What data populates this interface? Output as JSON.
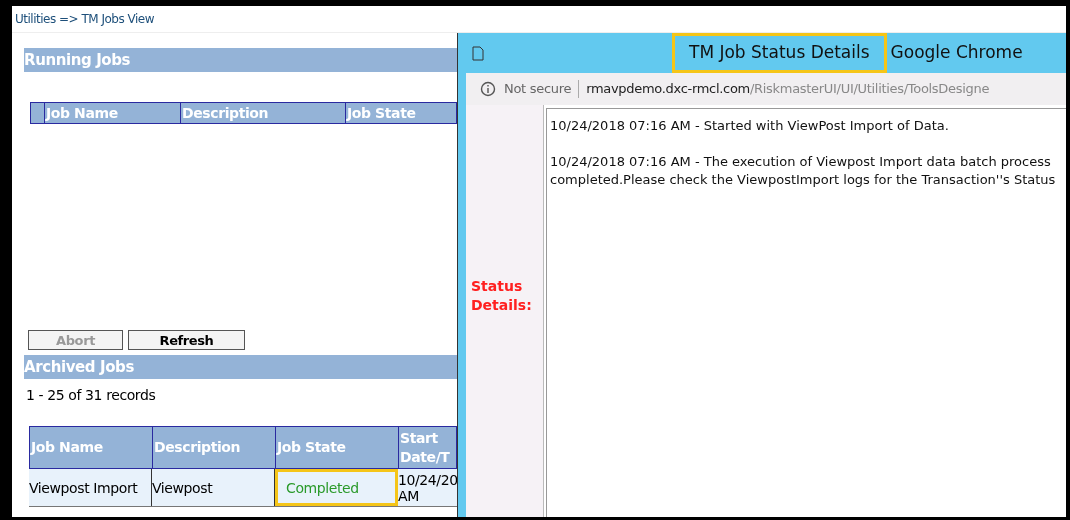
{
  "breadcrumb": "Utilities => TM Jobs View",
  "running_jobs": {
    "title": "Running Jobs",
    "columns": [
      "Job Name",
      "Description",
      "Job State"
    ],
    "buttons": [
      {
        "label": "Abort",
        "disabled": true
      },
      {
        "label": "Refresh",
        "disabled": false
      }
    ]
  },
  "archived_jobs": {
    "title": "Archived Jobs",
    "records": "1 - 25 of 31 records",
    "columns": [
      "Job Name",
      "Description",
      "Job State",
      "Start Date/T"
    ],
    "rows": [
      {
        "cells": [
          "Viewpost Import",
          "Viewpost",
          "Completed",
          "10/24/20 AM"
        ],
        "highlighted": true
      }
    ]
  },
  "popup": {
    "title": "TM Job Status Details",
    "title_highlighted": true,
    "app": "Google Chrome",
    "security": "Not secure",
    "url_host": "rmavpdemo.dxc-rmcl.com",
    "url_path": "/RiskmasterUI/UI/Utilities/ToolsDesigne",
    "label": "Status Details:",
    "status_paragraphs": [
      [
        "10/24/2018 07:16 AM - Started with ViewPost Import of Data."
      ],
      [
        "10/24/2018 07:16 AM - The execution of Viewpost Import data batch process",
        "completed.Please check the ViewpostImport logs for the Transaction''s Status"
      ]
    ]
  }
}
